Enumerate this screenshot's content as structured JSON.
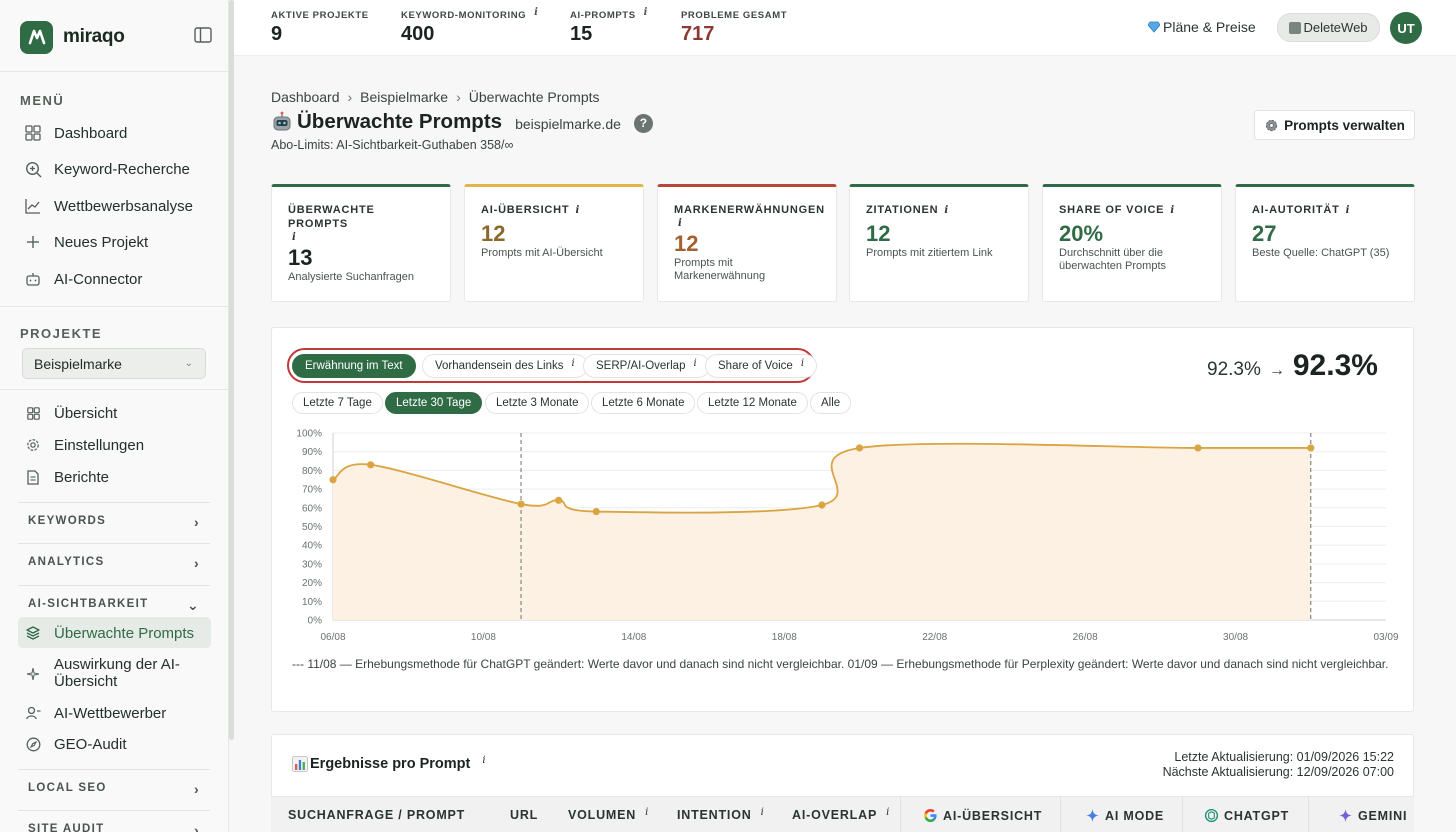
{
  "app": {
    "name": "miraqo"
  },
  "sidebar": {
    "menu_label": "MENÜ",
    "menu": [
      {
        "label": "Dashboard",
        "icon": "grid-icon"
      },
      {
        "label": "Keyword-Recherche",
        "icon": "search-plus-icon"
      },
      {
        "label": "Wettbewerbsanalyse",
        "icon": "line-chart-icon"
      },
      {
        "label": "Neues Projekt",
        "icon": "plus-icon"
      },
      {
        "label": "AI-Connector",
        "icon": "robot-icon"
      }
    ],
    "projects_label": "PROJEKTE",
    "project_select": "Beispielmarke",
    "project_items": [
      {
        "label": "Übersicht",
        "icon": "grid-icon"
      },
      {
        "label": "Einstellungen",
        "icon": "gear-icon"
      },
      {
        "label": "Berichte",
        "icon": "document-icon"
      }
    ],
    "groups": {
      "keywords": "KEYWORDS",
      "analytics": "ANALYTICS",
      "ai_visibility": "AI-SICHTBARKEIT",
      "local_seo": "LOCAL SEO",
      "site_audit": "SITE AUDIT"
    },
    "ai_items": [
      {
        "label": "Überwachte Prompts",
        "icon": "layers-icon"
      },
      {
        "label": "Auswirkung der AI-Übersicht",
        "icon": "sparkle-icon"
      },
      {
        "label": "AI-Wettbewerber",
        "icon": "users-icon"
      },
      {
        "label": "GEO-Audit",
        "icon": "compass-icon"
      }
    ]
  },
  "topbar": {
    "stats": [
      {
        "label": "AKTIVE PROJEKTE",
        "value": "9",
        "info": ""
      },
      {
        "label": "KEYWORD-MONITORING",
        "value": "400",
        "info": "i"
      },
      {
        "label": "AI-PROMPTS",
        "value": "15",
        "info": "i"
      },
      {
        "label": "PROBLEME GESAMT",
        "value": "717",
        "info": ""
      }
    ],
    "plans": "Pläne & Preise",
    "workspace": "DeleteWeb",
    "avatar": "UT"
  },
  "header": {
    "breadcrumb": [
      "Dashboard",
      "Beispielmarke",
      "Überwachte Prompts"
    ],
    "sep": "›",
    "title": "Überwachte Prompts",
    "domain": "beispielmarke.de",
    "help": "?",
    "abo": "Abo-Limits: AI-Sichtbarkeit-Guthaben 358/∞",
    "manage_button": "Prompts verwalten"
  },
  "cards": [
    {
      "label": "ÜBERWACHTE PROMPTS",
      "value": "13",
      "sub": "Analysierte Suchanfragen",
      "accent": "#2f6b45",
      "value_color": "#1b2420"
    },
    {
      "label": "AI-ÜBERSICHT",
      "value": "12",
      "sub": "Prompts mit AI-Übersicht",
      "accent": "#e2b44a",
      "value_color": "#8a6a2a"
    },
    {
      "label": "MARKENERWÄHNUNGEN",
      "value": "12",
      "sub": "Prompts mit Markenerwähnung",
      "accent": "#b5483a",
      "value_color": "#a2612e"
    },
    {
      "label": "ZITATIONEN",
      "value": "12",
      "sub": "Prompts mit zitiertem Link",
      "accent": "#2f6b45",
      "value_color": "#2f6b45"
    },
    {
      "label": "SHARE OF VOICE",
      "value": "20%",
      "sub": "Durchschnitt über die überwachten Prompts",
      "accent": "#2f6b45",
      "value_color": "#2f6b45"
    },
    {
      "label": "AI-AUTORITÄT",
      "value": "27",
      "sub": "Beste Quelle: ChatGPT (35)",
      "accent": "#2f6b45",
      "value_color": "#2f6b45"
    }
  ],
  "chart_panel": {
    "toggles": [
      "Erwähnung im Text",
      "Vorhandensein des Links",
      "SERP/AI-Overlap",
      "Share of Voice"
    ],
    "ranges": [
      "Letzte 7 Tage",
      "Letzte 30 Tage",
      "Letzte 3 Monate",
      "Letzte 6 Monate",
      "Letzte 12 Monate",
      "Alle"
    ],
    "from_value": "92.3%",
    "arrow": "→",
    "to_value": "92.3%",
    "note": "--- 11/08 — Erhebungsmethode für ChatGPT geändert: Werte davor und danach sind nicht vergleichbar. 01/09 — Erhebungsmethode für Perplexity geändert: Werte davor und danach sind nicht vergleichbar."
  },
  "chart_data": {
    "type": "area",
    "x_ticks": [
      "06/08",
      "10/08",
      "14/08",
      "18/08",
      "22/08",
      "26/08",
      "30/08",
      "03/09"
    ],
    "y_ticks": [
      "0%",
      "10%",
      "20%",
      "30%",
      "40%",
      "50%",
      "60%",
      "70%",
      "80%",
      "90%",
      "100%"
    ],
    "ylim": [
      0,
      100
    ],
    "x_day_range": [
      6,
      34
    ],
    "points": [
      {
        "day": 6.0,
        "y": 75
      },
      {
        "day": 7.0,
        "y": 83
      },
      {
        "day": 11.0,
        "y": 62
      },
      {
        "day": 12.0,
        "y": 64
      },
      {
        "day": 13.0,
        "y": 58
      },
      {
        "day": 19.0,
        "y": 61.5
      },
      {
        "day": 20.0,
        "y": 92
      },
      {
        "day": 29.0,
        "y": 92
      },
      {
        "day": 32.0,
        "y": 92
      }
    ],
    "markers": [
      11,
      32
    ],
    "color": "#d9a441",
    "fill": "#fdf1e4"
  },
  "results": {
    "title": "Ergebnisse pro Prompt",
    "last_update": "Letzte Aktualisierung: 01/09/2026 15:22",
    "next_update": "Nächste Aktualisierung: 12/09/2026 07:00",
    "columns": {
      "prompt": "SUCHANFRAGE / PROMPT",
      "url": "URL",
      "volume": "VOLUMEN",
      "intent": "INTENTION",
      "overlap": "AI-OVERLAP",
      "ai_overview": "AI-ÜBERSICHT",
      "ai_mode": "AI MODE",
      "chatgpt": "CHATGPT",
      "gemini": "GEMINI"
    }
  }
}
